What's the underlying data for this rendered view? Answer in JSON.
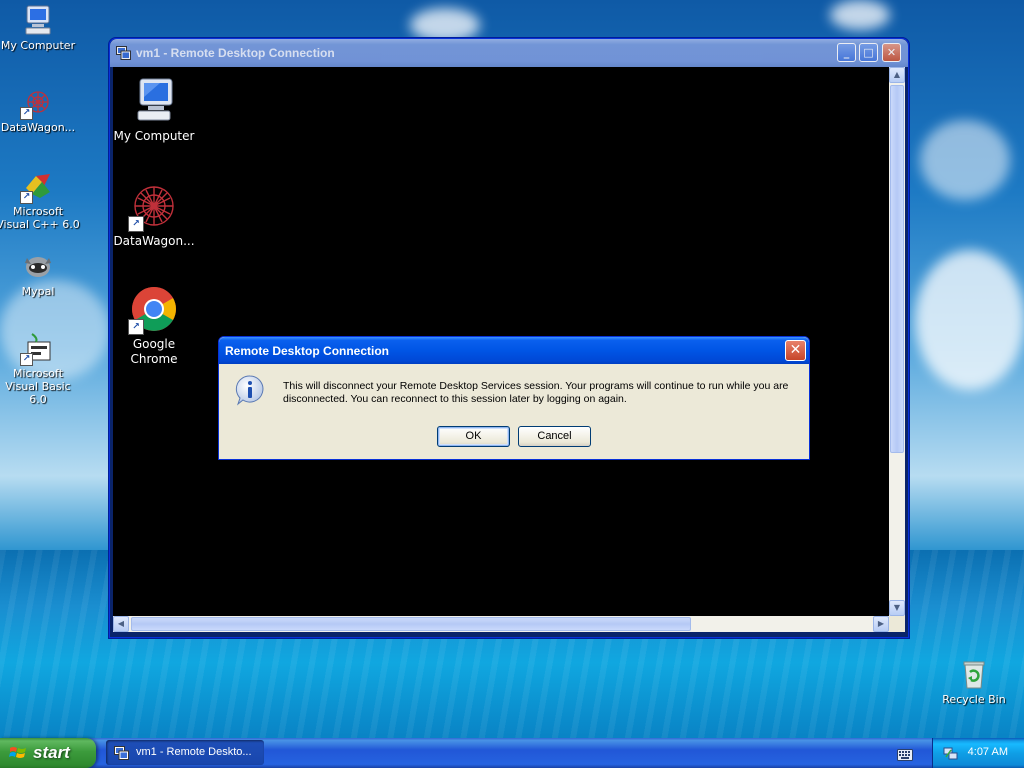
{
  "desktop": {
    "icons": [
      {
        "label": "My Computer",
        "icon": "my-computer-icon"
      },
      {
        "label": "DataWagon...",
        "icon": "datawagon-icon"
      },
      {
        "label": "Microsoft Visual C++ 6.0",
        "icon": "visual-cpp-icon"
      },
      {
        "label": "Mypal",
        "icon": "mypal-icon"
      },
      {
        "label": "Microsoft Visual Basic 6.0",
        "icon": "visual-basic-icon"
      }
    ],
    "recycle_bin": {
      "label": "Recycle Bin",
      "icon": "recycle-bin-icon"
    }
  },
  "rdp_window": {
    "title": "vm1 - Remote Desktop Connection",
    "buttons": {
      "minimize": "_",
      "maximize": "□",
      "close": "✕"
    },
    "remote_icons": [
      {
        "label": "My Computer",
        "icon": "my-computer-icon"
      },
      {
        "label": "DataWagon...",
        "icon": "datawagon-icon"
      },
      {
        "label": "Google Chrome",
        "icon": "chrome-icon"
      }
    ]
  },
  "dialog": {
    "title": "Remote Desktop Connection",
    "message": "This will disconnect your Remote Desktop Services session. Your programs will continue to run while you are disconnected. You can reconnect to this session later by logging on again.",
    "ok_label": "OK",
    "cancel_label": "Cancel",
    "icon": "info-icon"
  },
  "taskbar": {
    "start_label": "start",
    "task_item_label": "vm1 - Remote Deskto...",
    "clock": "4:07 AM"
  },
  "colors": {
    "xp_blue": "#0054e3",
    "start_green": "#3c9b3c",
    "dialog_bg": "#ece9d8"
  }
}
